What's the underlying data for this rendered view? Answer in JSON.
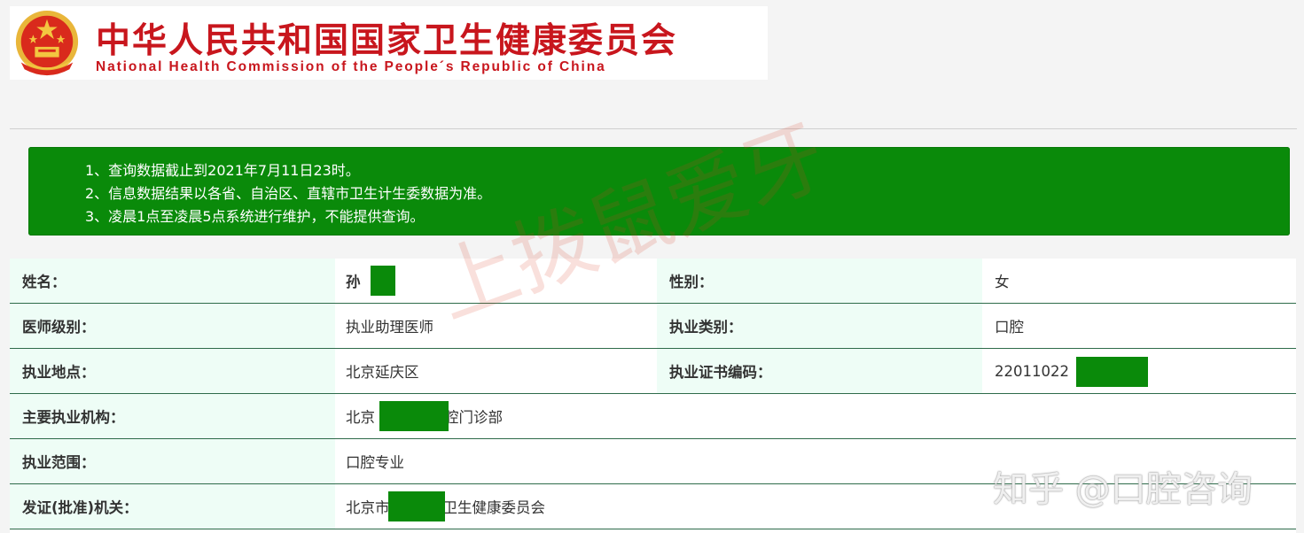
{
  "header": {
    "title_cn": "中华人民共和国国家卫生健康委员会",
    "title_en": "National Health Commission of the People´s Republic of China",
    "emblem_icon": "national-emblem-icon"
  },
  "notice": {
    "lines": [
      "1、查询数据截止到2021年7月11日23时。",
      "2、信息数据结果以各省、自治区、直辖市卫生计生委数据为准。",
      "3、凌晨1点至凌晨5点系统进行维护，不能提供查询。"
    ]
  },
  "table": {
    "rows": [
      {
        "label1": "姓名：",
        "value1": "孙",
        "label2": "性别：",
        "value2": "女"
      },
      {
        "label1": "医师级别：",
        "value1": "执业助理医师",
        "label2": "执业类别：",
        "value2": "口腔"
      },
      {
        "label1": "执业地点：",
        "value1": "北京延庆区",
        "label2": "执业证书编码：",
        "value2": "22011022"
      },
      {
        "label1": "主要执业机构：",
        "value1": "北京",
        "value1_suffix": "腔门诊部"
      },
      {
        "label1": "执业范围：",
        "value1": "口腔专业"
      },
      {
        "label1": "发证(批准)机关：",
        "value1": "北京市",
        "value1_suffix": "卫生健康委员会"
      }
    ]
  },
  "watermarks": {
    "overlay": "上拨鼠爱牙",
    "zhihu": "知乎 @口腔咨询"
  },
  "colors": {
    "brand_red": "#c8161d",
    "notice_green": "#0a8a0a",
    "label_bg": "#eefdf6",
    "row_border": "#2e6b4a",
    "redaction": "#0a8a0a"
  }
}
